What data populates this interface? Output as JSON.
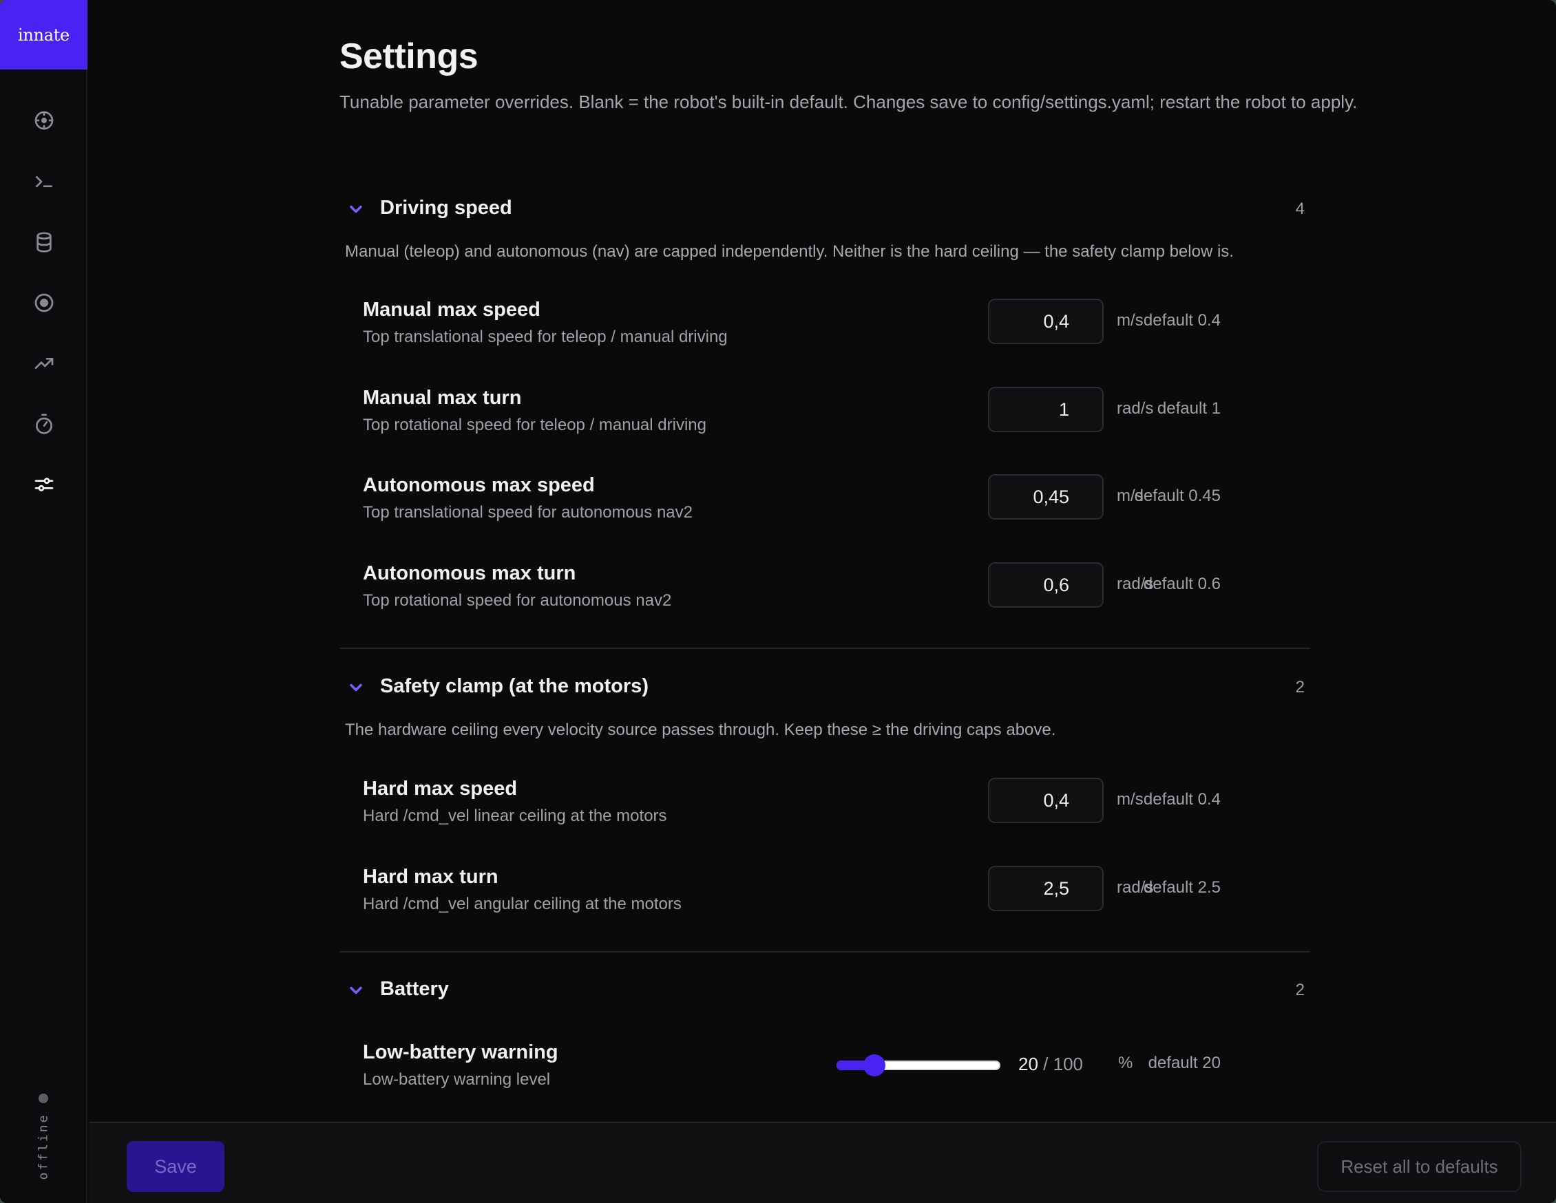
{
  "sidebar": {
    "logo": "innate",
    "icons": [
      "crosshair-icon",
      "terminal-icon",
      "database-icon",
      "record-icon",
      "trending-icon",
      "stopwatch-icon",
      "sliders-icon"
    ],
    "status": "offline"
  },
  "page": {
    "title": "Settings",
    "description": "Tunable parameter overrides. Blank = the robot's built-in default. Changes save to config/settings.yaml; restart the robot to apply."
  },
  "sections": [
    {
      "title": "Driving speed",
      "count": "4",
      "description": "Manual (teleop) and autonomous (nav) are capped independently. Neither is the hard ceiling — the safety clamp below is.",
      "rows": [
        {
          "label": "Manual max speed",
          "sub": "Top translational speed for teleop / manual driving",
          "value": "0,4",
          "unit": "m/s",
          "default": "default 0.4"
        },
        {
          "label": "Manual max turn",
          "sub": "Top rotational speed for teleop / manual driving",
          "value": "1",
          "unit": "rad/s",
          "default": "default 1"
        },
        {
          "label": "Autonomous max speed",
          "sub": "Top translational speed for autonomous nav2",
          "value": "0,45",
          "unit": "m/s",
          "default": "default 0.45"
        },
        {
          "label": "Autonomous max turn",
          "sub": "Top rotational speed for autonomous nav2",
          "value": "0,6",
          "unit": "rad/s",
          "default": "default 0.6"
        }
      ]
    },
    {
      "title": "Safety clamp (at the motors)",
      "count": "2",
      "description": "The hardware ceiling every velocity source passes through. Keep these ≥ the driving caps above.",
      "rows": [
        {
          "label": "Hard max speed",
          "sub": "Hard /cmd_vel linear ceiling at the motors",
          "value": "0,4",
          "unit": "m/s",
          "default": "default 0.4"
        },
        {
          "label": "Hard max turn",
          "sub": "Hard /cmd_vel angular ceiling at the motors",
          "value": "2,5",
          "unit": "rad/s",
          "default": "default 2.5"
        }
      ]
    },
    {
      "title": "Battery",
      "count": "2",
      "rows": [
        {
          "label": "Low-battery warning",
          "sub": "Low-battery warning level",
          "value": "20",
          "max": "100",
          "separator": "/",
          "unit": "%",
          "default": "default 20",
          "level": 20
        }
      ]
    }
  ],
  "footer": {
    "save_label": "Save",
    "reset_label": "Reset all to defaults"
  },
  "colors": {
    "accent": "#4a22f2",
    "chevron": "#7b5cff",
    "background": "#0a0a0b"
  }
}
